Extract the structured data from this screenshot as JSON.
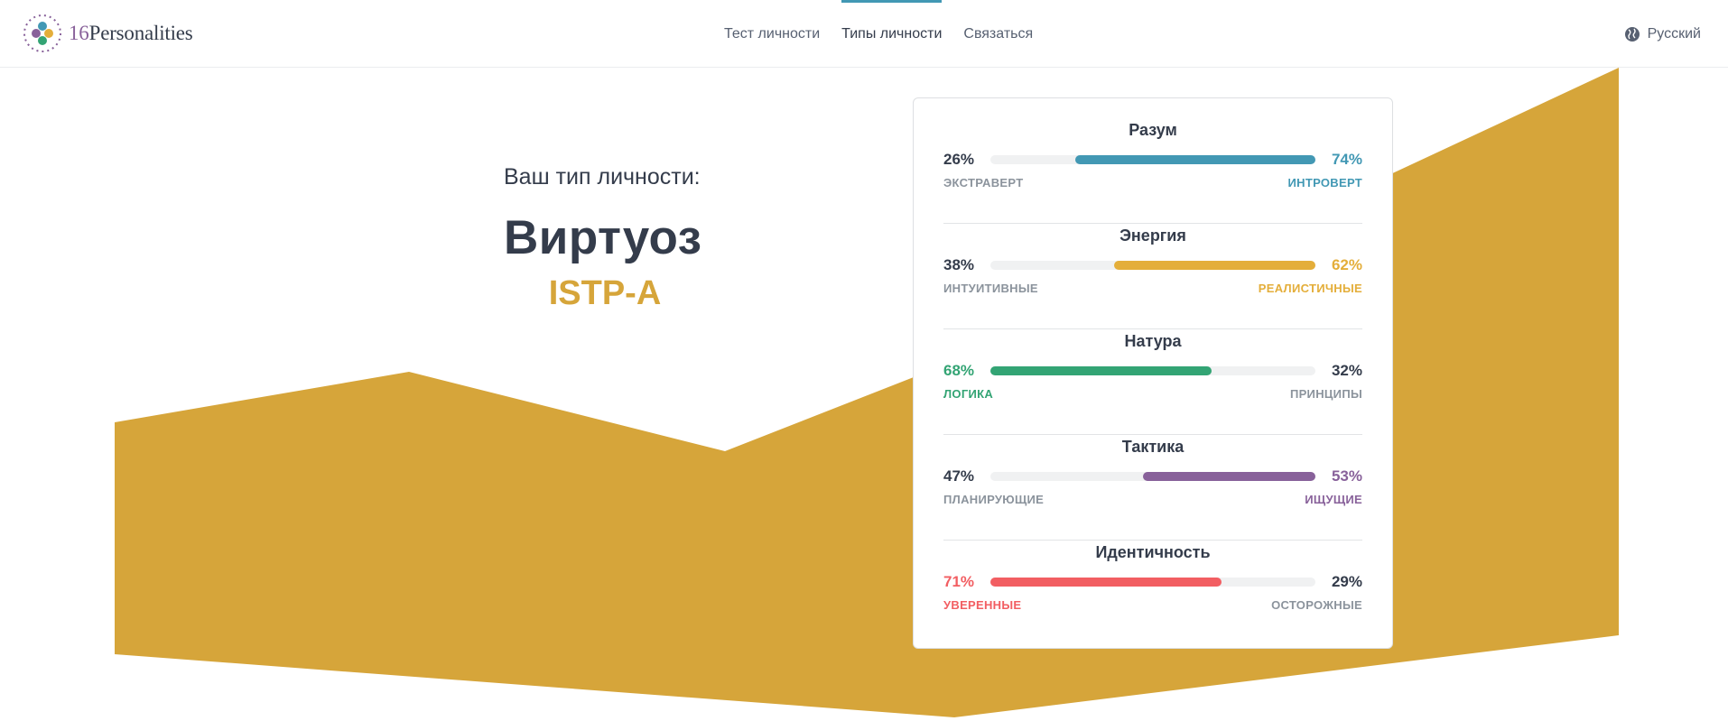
{
  "header": {
    "logo_number": "16",
    "logo_word": "Personalities",
    "nav": [
      {
        "label": "Тест личности",
        "active": false
      },
      {
        "label": "Типы личности",
        "active": true
      },
      {
        "label": "Связаться",
        "active": false
      }
    ],
    "language": "Русский"
  },
  "intro": {
    "label": "Ваш тип личности:",
    "type_name": "Виртуоз",
    "type_code": "ISTP-A"
  },
  "colors": {
    "accent_yellow": "#d6a53a",
    "blue": "#4298b4",
    "green": "#33a474",
    "purple": "#88619a",
    "red": "#f25e62"
  },
  "traits": [
    {
      "title": "Разум",
      "left_pct": "26%",
      "right_pct": "74%",
      "left_label": "ЭКСТРАВЕРТ",
      "right_label": "ИНТРОВЕРТ",
      "dominant": "right",
      "value": 74,
      "color": "#4298b4"
    },
    {
      "title": "Энергия",
      "left_pct": "38%",
      "right_pct": "62%",
      "left_label": "ИНТУИТИВНЫЕ",
      "right_label": "РЕАЛИСТИЧНЫЕ",
      "dominant": "right",
      "value": 62,
      "color": "#e4ae3a"
    },
    {
      "title": "Натура",
      "left_pct": "68%",
      "right_pct": "32%",
      "left_label": "ЛОГИКА",
      "right_label": "ПРИНЦИПЫ",
      "dominant": "left",
      "value": 68,
      "color": "#33a474"
    },
    {
      "title": "Тактика",
      "left_pct": "47%",
      "right_pct": "53%",
      "left_label": "ПЛАНИРУЮЩИЕ",
      "right_label": "ИЩУЩИЕ",
      "dominant": "right",
      "value": 53,
      "color": "#88619a"
    },
    {
      "title": "Идентичность",
      "left_pct": "71%",
      "right_pct": "29%",
      "left_label": "УВЕРЕННЫЕ",
      "right_label": "ОСТОРОЖНЫЕ",
      "dominant": "left",
      "value": 71,
      "color": "#f25e62"
    }
  ]
}
